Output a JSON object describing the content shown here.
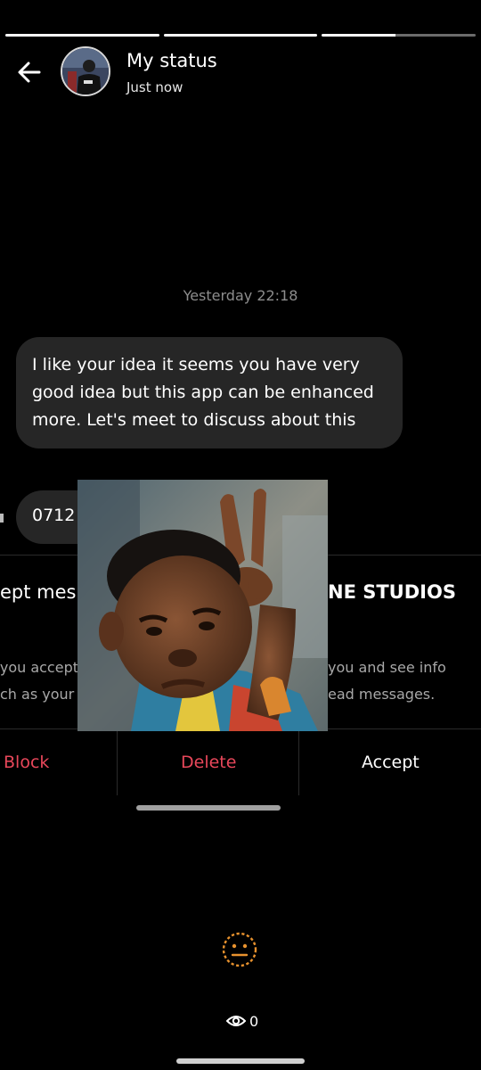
{
  "progress": {
    "segments": 3,
    "current_segment": 3,
    "current_progress": 0.48
  },
  "header": {
    "back_icon": "arrow-left-icon",
    "title": "My status",
    "time": "Just now"
  },
  "screenshot": {
    "timestamp": "Yesterday 22:18",
    "message": "I like your idea it seems you have very good idea but this app can be enhanced more. Let's meet to discuss about this",
    "phone_snippet": "0712",
    "request_heading_left": "ept mes",
    "request_heading_right": "NE STUDIOS",
    "info_left": [
      "you accept,",
      "ch as your"
    ],
    "info_right": [
      "you and see info",
      "ead messages."
    ],
    "actions": {
      "block": "Block",
      "delete": "Delete",
      "accept": "Accept"
    },
    "colors": {
      "danger": "#e8475a",
      "bubble": "#262626"
    }
  },
  "footer": {
    "reaction_icon": "neutral-face-icon",
    "reaction_color": "#e8922e",
    "views_icon": "eye-icon",
    "views_count": "0"
  }
}
